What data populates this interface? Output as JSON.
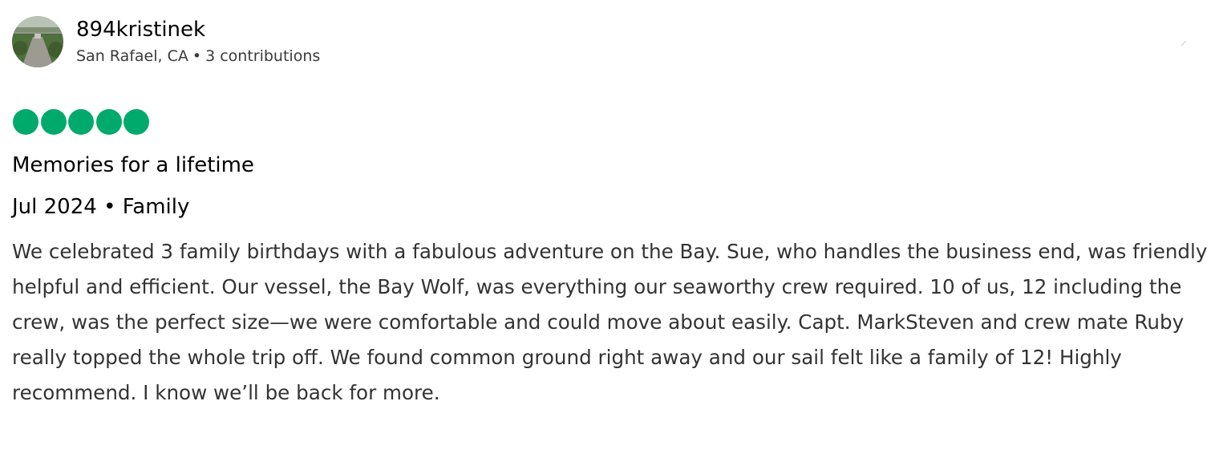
{
  "user": {
    "name": "894kristinek",
    "location": "San Rafael, CA",
    "separator": "•",
    "contributions": "3 contributions"
  },
  "review": {
    "rating": 5,
    "rating_max": 5,
    "title": "Memories for a lifetime",
    "date": "Jul 2024",
    "separator": "•",
    "trip_type": "Family",
    "body": "We celebrated 3 family birthdays with a fabulous adventure on the Bay. Sue, who handles the business end, was friendly helpful and efficient. Our vessel, the Bay Wolf, was everything our seaworthy crew required. 10 of us, 12 including the crew, was the perfect size—we were comfortable and could move about easily. Capt. MarkSteven and crew mate Ruby really topped the whole trip off. We found common ground right away and our sail felt like a family of 12! Highly recommend. I know we’ll be back for more."
  },
  "icons": {
    "avatar": "avatar-garden-photo",
    "rating": "rating-bubble-icon",
    "menu": "more-options-icon"
  },
  "colors": {
    "rating_fill": "#00aa6c",
    "text_primary": "#000000",
    "text_secondary": "#333333"
  }
}
